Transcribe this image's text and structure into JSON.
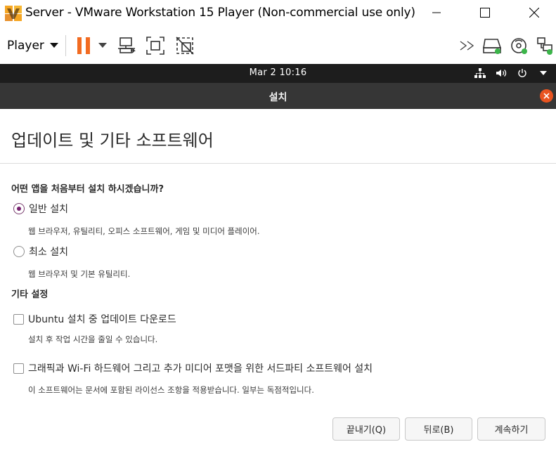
{
  "window": {
    "title": "Server - VMware Workstation 15 Player (Non-commercial use only)"
  },
  "toolbar": {
    "player_label": "Player",
    "pause_color": "#f26b21"
  },
  "ubuntu_topbar": {
    "clock": "Mar 2  10:16"
  },
  "installer": {
    "header_title": "설치",
    "page_title": "업데이트 및 기타 소프트웨어",
    "question": "어떤 앱을 처음부터 설치 하시겠습니까?",
    "options": [
      {
        "label": "일반 설치",
        "description": "웹 브라우저, 유틸리티, 오피스  소프트웨어, 게임 및 미디어 플레이어.",
        "selected": true
      },
      {
        "label": "최소 설치",
        "description": "웹 브라우저 및 기본 유틸리티.",
        "selected": false
      }
    ],
    "other_heading": "기타 설정",
    "other_options": [
      {
        "label": "Ubuntu 설치 중 업데이트 다운로드",
        "description": "설치 후 작업 시간을 줄일 수 있습니다.",
        "checked": false
      },
      {
        "label": "그래픽과 Wi-Fi 하드웨어 그리고 추가 미디어 포맷을 위한 서드파티 소프트웨어 설치",
        "description": "이 소프트웨어는 문서에 포함된 라이선스 조항을 적용받습니다. 일부는 독점적입니다.",
        "checked": false
      }
    ],
    "buttons": {
      "quit": "끝내기(Q)",
      "back": "뒤로(B)",
      "continue": "계속하기"
    }
  },
  "colors": {
    "ubuntu_orange": "#e95420",
    "ubuntu_aubergine": "#77216f",
    "topbar_bg": "#1d1d1d",
    "header_bg": "#363636",
    "status_green": "#3bb54a"
  }
}
